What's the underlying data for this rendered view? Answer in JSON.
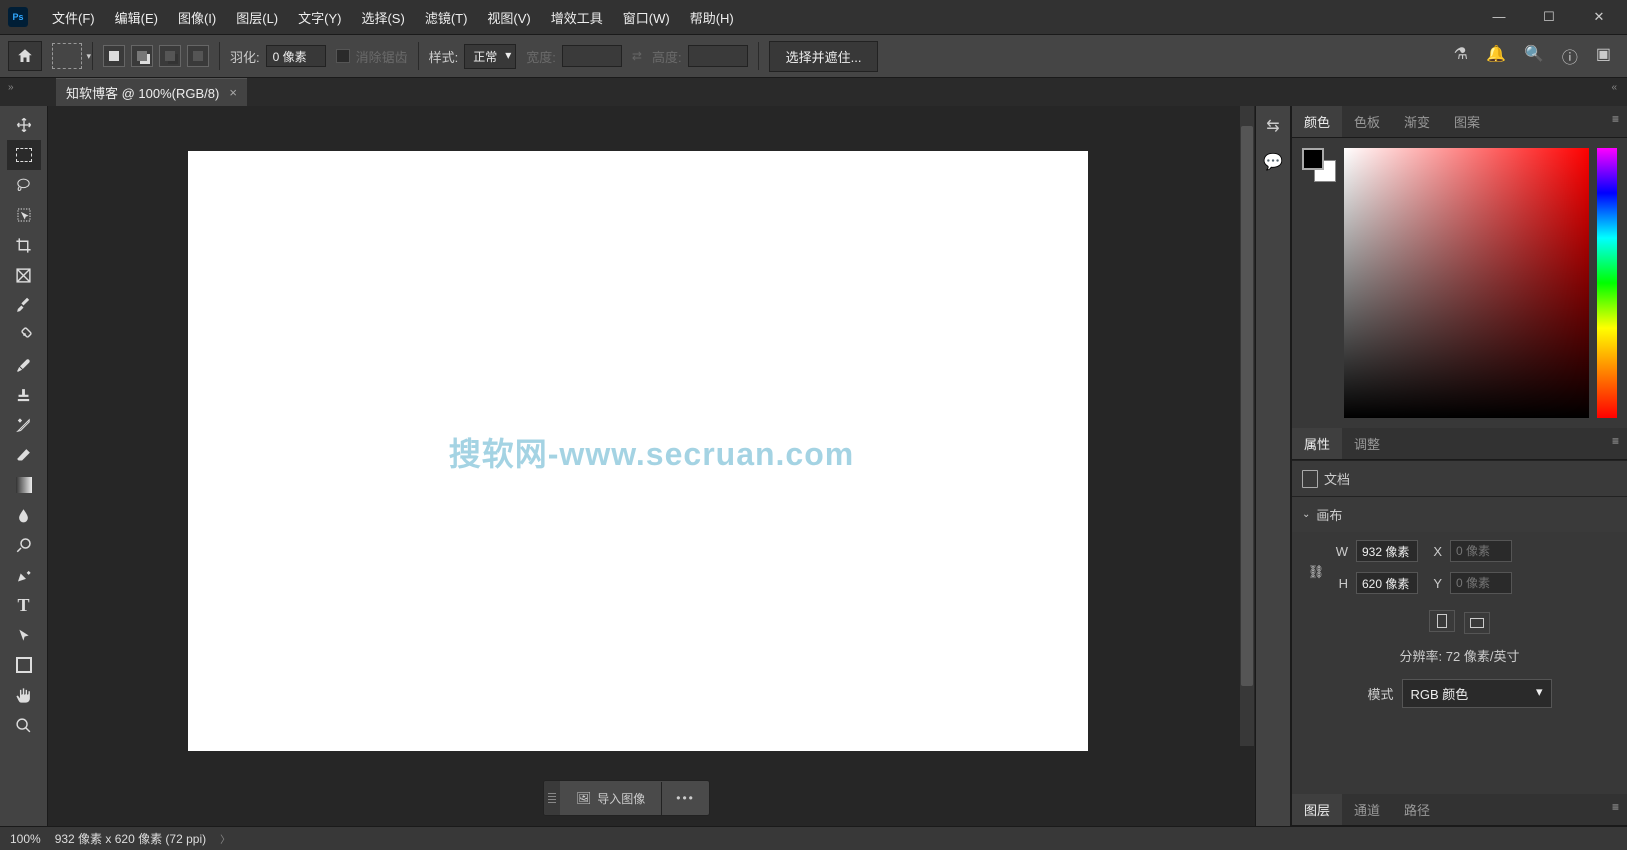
{
  "menu": {
    "items": [
      "文件(F)",
      "编辑(E)",
      "图像(I)",
      "图层(L)",
      "文字(Y)",
      "选择(S)",
      "滤镜(T)",
      "视图(V)",
      "增效工具",
      "窗口(W)",
      "帮助(H)"
    ]
  },
  "options": {
    "feather_label": "羽化:",
    "feather_value": "0 像素",
    "antialias_label": "消除锯齿",
    "style_label": "样式:",
    "style_value": "正常",
    "width_label": "宽度:",
    "height_label": "高度:",
    "mask_button": "选择并遮住..."
  },
  "tab": {
    "title": "知软博客 @ 100%(RGB/8)"
  },
  "watermark": "搜软网-www.secruan.com",
  "import_button": "导入图像",
  "statusbar": {
    "zoom": "100%",
    "info": "932 像素 x 620 像素 (72 ppi)"
  },
  "right": {
    "tabs1": [
      "颜色",
      "色板",
      "渐变",
      "图案"
    ],
    "tabs2": [
      "属性",
      "调整"
    ],
    "tabs3": [
      "图层",
      "通道",
      "路径"
    ],
    "doc_label": "文档",
    "canvas_label": "画布",
    "w_label": "W",
    "h_label": "H",
    "x_label": "X",
    "y_label": "Y",
    "w_value": "932 像素",
    "h_value": "620 像素",
    "xy_placeholder": "0 像素",
    "resolution_label": "分辨率: 72 像素/英寸",
    "mode_label": "模式",
    "mode_value": "RGB 颜色"
  }
}
